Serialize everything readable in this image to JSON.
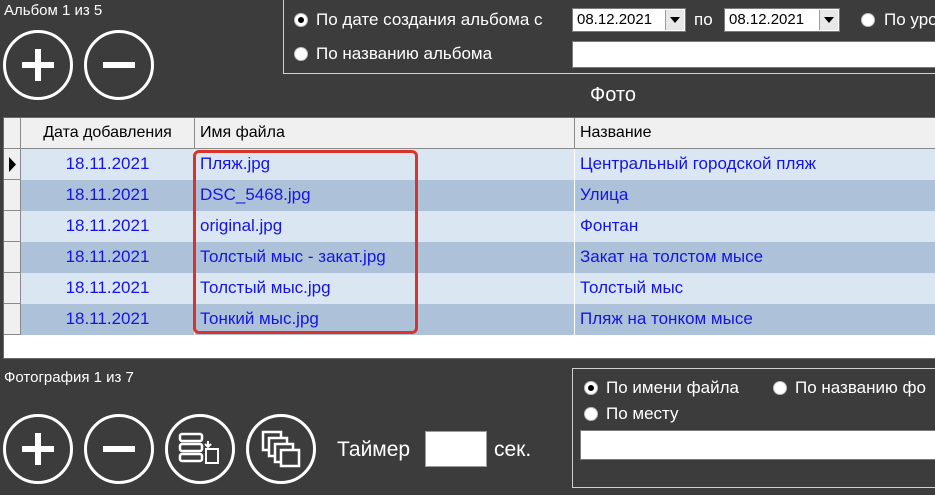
{
  "album": {
    "counter": "Альбом 1 из 5",
    "add_icon": "plus-icon",
    "remove_icon": "minus-icon"
  },
  "album_filter": {
    "by_date_label": "По дате создания альбома с",
    "date_from": "08.12.2021",
    "to_label": "по",
    "date_to": "08.12.2021",
    "by_level_label": "По уро",
    "by_name_label": "По названию альбома",
    "name_value": ""
  },
  "photos": {
    "section_title": "Фото",
    "columns": [
      "Дата добавления",
      "Имя файла",
      "Название"
    ],
    "rows": [
      {
        "date": "18.11.2021",
        "file": "Пляж.jpg",
        "title": "Центральный городской пляж"
      },
      {
        "date": "18.11.2021",
        "file": "DSC_5468.jpg",
        "title": "Улица"
      },
      {
        "date": "18.11.2021",
        "file": "original.jpg",
        "title": "Фонтан"
      },
      {
        "date": "18.11.2021",
        "file": "Толстый мыс - закат.jpg",
        "title": "Закат на толстом мысе"
      },
      {
        "date": "18.11.2021",
        "file": "Толстый мыс.jpg",
        "title": "Толстый мыс"
      },
      {
        "date": "18.11.2021",
        "file": "Тонкий мыс.jpg",
        "title": "Пляж на тонком мысе"
      }
    ],
    "row_colors": [
      "#dae6f2",
      "#adc2d8"
    ],
    "highlight_color": "#d9342b"
  },
  "photo_nav": {
    "counter": "Фотография 1 из 7",
    "timer_label": "Таймер",
    "timer_value": "",
    "seconds_label": "сек."
  },
  "photo_filter": {
    "by_filename_label": "По имени файла",
    "by_title_label": "По названию фо",
    "by_place_label": "По месту",
    "search_value": ""
  }
}
